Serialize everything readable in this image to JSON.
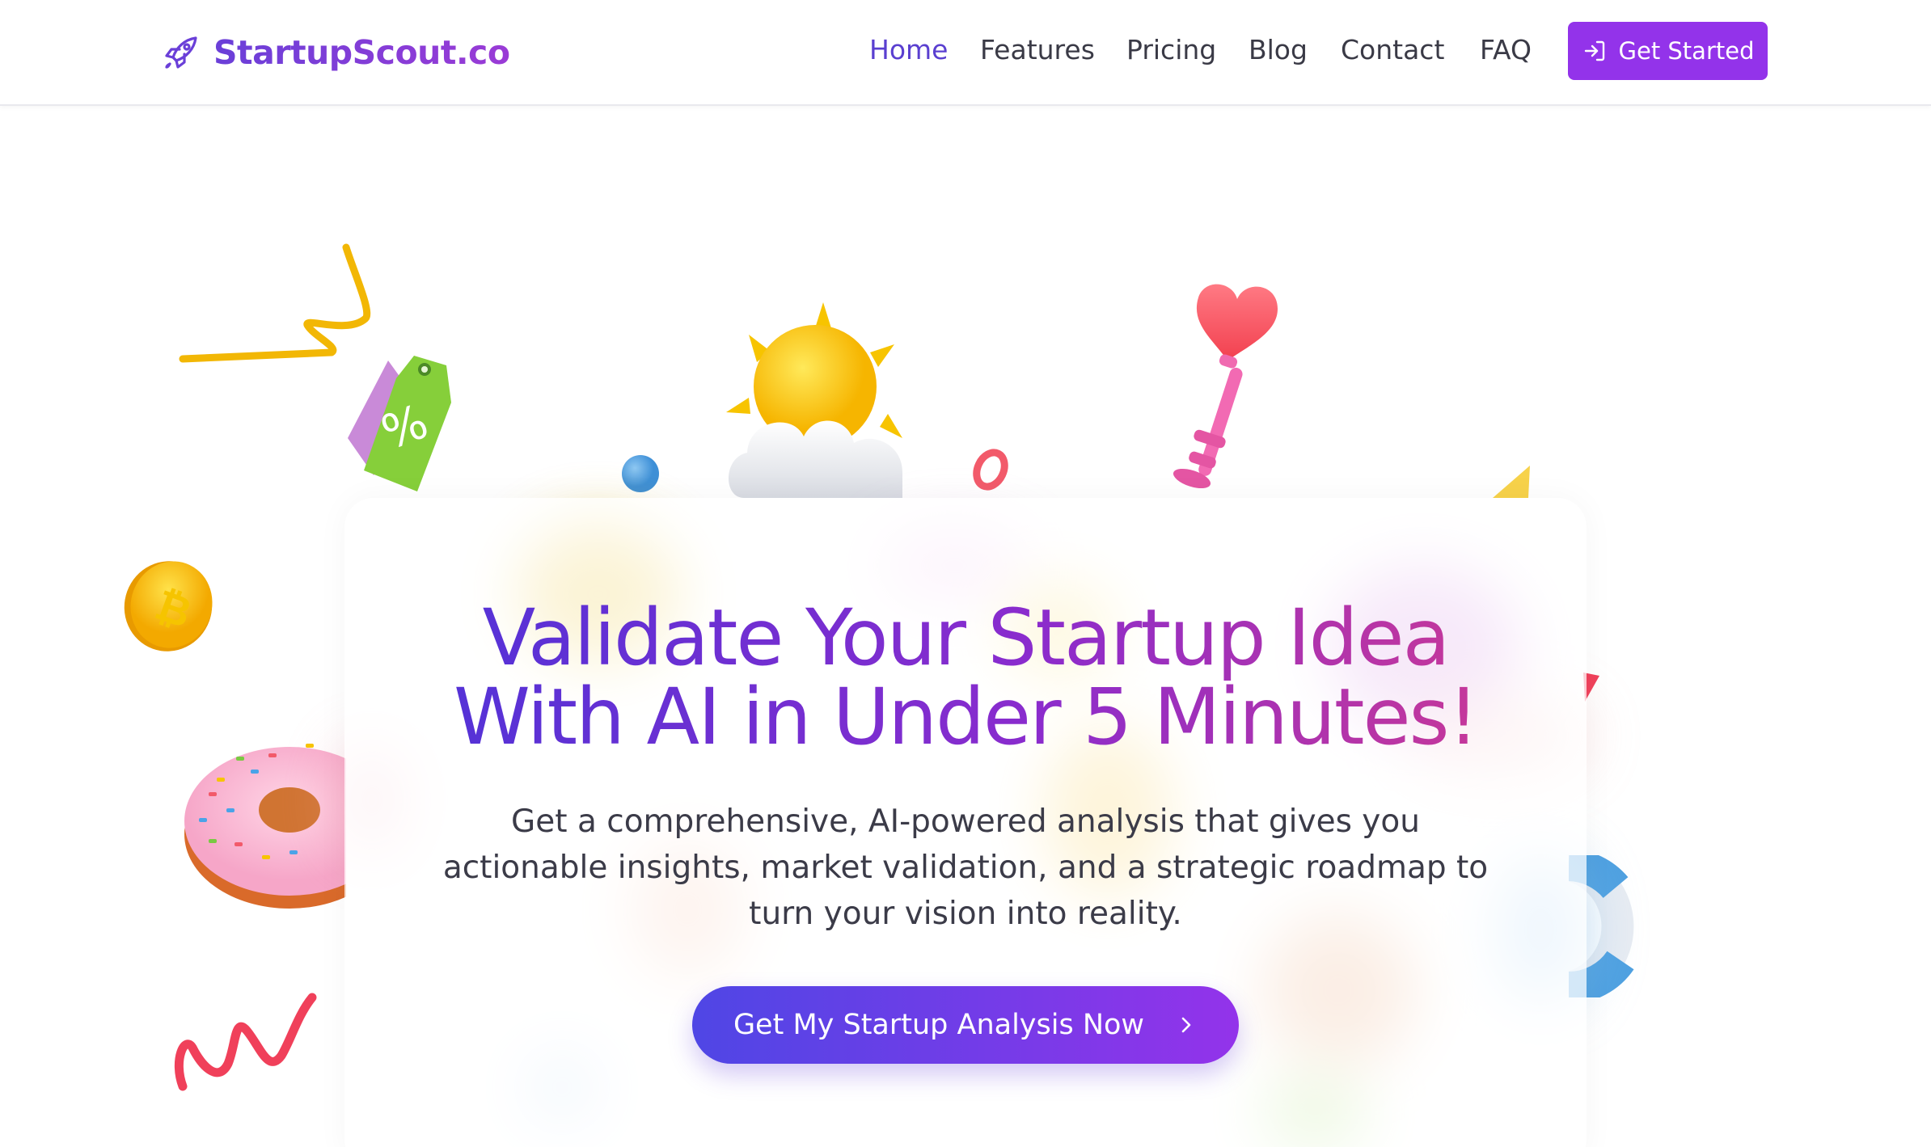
{
  "brand": {
    "name": "StartupScout.co",
    "icon": "rocket-icon",
    "color": "#7c3aed"
  },
  "nav": {
    "items": [
      {
        "label": "Home",
        "active": true
      },
      {
        "label": "Features",
        "active": false
      },
      {
        "label": "Pricing",
        "active": false
      },
      {
        "label": "Blog",
        "active": false
      },
      {
        "label": "Contact",
        "active": false
      },
      {
        "label": "FAQ",
        "active": false
      }
    ],
    "cta": {
      "label": "Get Started",
      "icon": "login-arrow-icon"
    }
  },
  "hero": {
    "title_line1": "Validate Your Startup Idea",
    "title_line2": "With AI in Under 5 Minutes!",
    "subtitle": "Get a comprehensive, AI-powered analysis that gives you actionable insights, market validation, and a strategic roadmap to turn your vision into reality.",
    "button": {
      "label": "Get My Startup Analysis Now",
      "icon": "chevron-right-icon"
    }
  },
  "colors": {
    "accent": "#9333ea",
    "accent_indigo": "#4f46e5",
    "nav_active": "#5a3fd0",
    "text": "#3b3b48"
  },
  "decorations": [
    "zigzag-ribbon-icon",
    "price-tag-icon",
    "sun-cloud-icon",
    "heart-key-icon",
    "coin-icon",
    "donut-icon",
    "spring-icon",
    "blue-ball-icon",
    "ring-icon",
    "life-ring-icon"
  ]
}
